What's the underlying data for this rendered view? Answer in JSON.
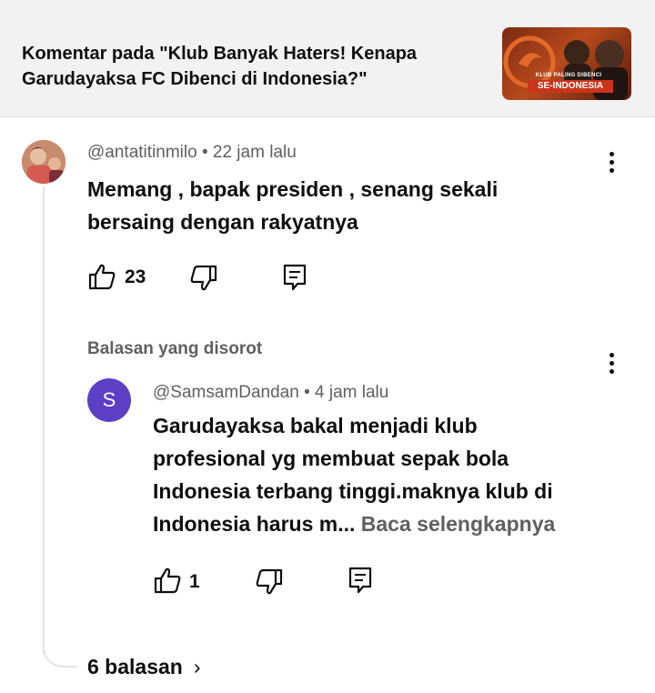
{
  "header": {
    "title": "Komentar pada \"Klub Banyak Haters! Kenapa Garudayaksa FC Dibenci di Indonesia?\"",
    "thumbnail": {
      "line1": "KLUB PALING DIBENCI",
      "line2": "SE-INDONESIA",
      "colors": {
        "bg": "#b84a1c",
        "band": "#c9341a"
      }
    }
  },
  "comment": {
    "author": "@antatitinmilo",
    "time": "22 jam lalu",
    "text_line1": "Memang , bapak presiden , senang sekali",
    "text_line2": "bersaing dengan rakyatnya",
    "likes": "23",
    "menu_icon": "more-vert-icon"
  },
  "highlighted": {
    "label": "Balasan yang disorot",
    "reply": {
      "avatar_letter": "S",
      "author": "@SamsamDandan",
      "time": "4 jam lalu",
      "text_line1": "Garudayaksa bakal menjadi klub",
      "text_line2": "profesional yg membuat sepak bola",
      "text_line3": "Indonesia terbang tinggi.maknya klub di",
      "text_line4": "Indonesia harus m...",
      "read_more": "Baca selengkapnya",
      "likes": "1"
    }
  },
  "replies": {
    "label": "6 balasan",
    "chevron": "›"
  },
  "colors": {
    "avatar_reply": "#5b3fc4",
    "secondary_text": "#606060",
    "header_bg": "#f2f2f2"
  }
}
